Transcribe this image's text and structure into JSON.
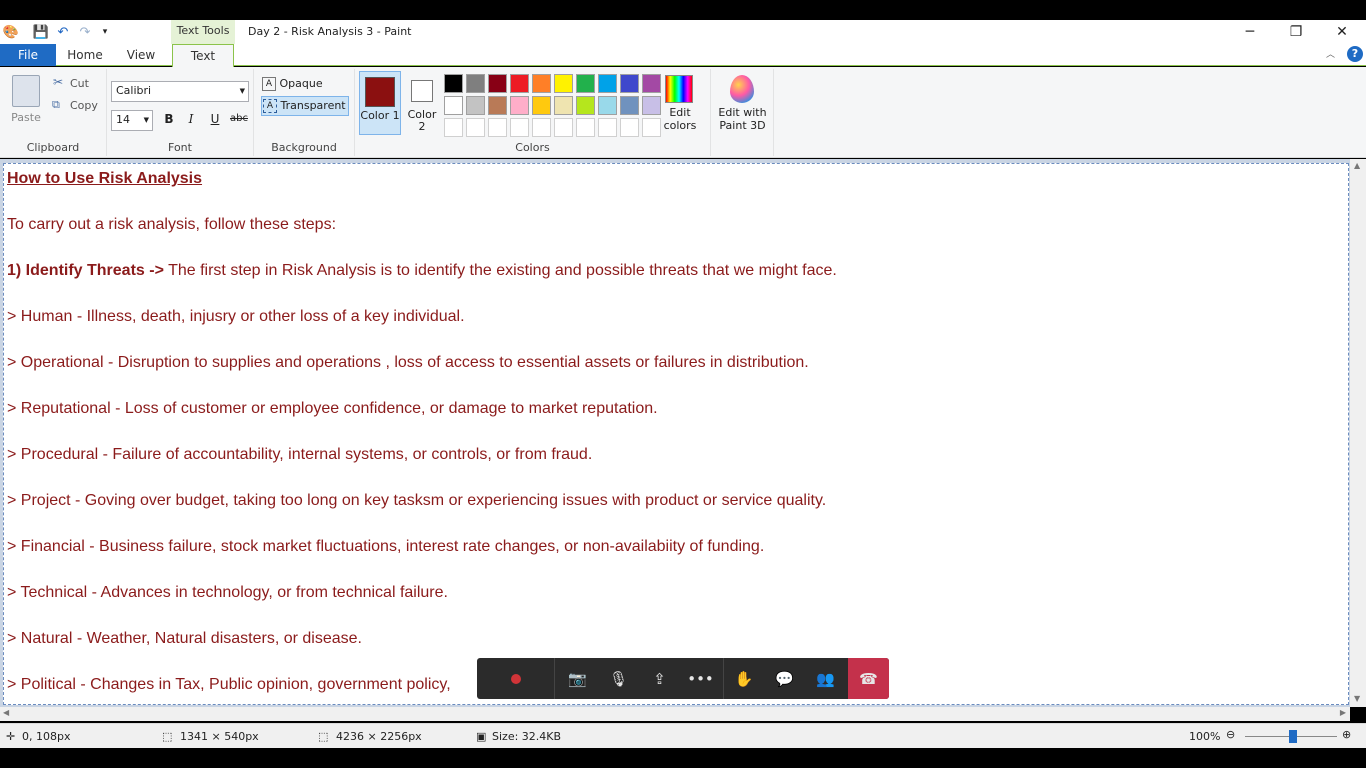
{
  "window": {
    "title": "Day 2 - Risk Analysis 3 - Paint",
    "contextual_tab": "Text Tools"
  },
  "tabs": {
    "file": "File",
    "home": "Home",
    "view": "View",
    "text": "Text"
  },
  "ribbon": {
    "clipboard": {
      "paste": "Paste",
      "cut": "Cut",
      "copy": "Copy",
      "label": "Clipboard"
    },
    "font": {
      "family": "Calibri",
      "size": "14",
      "bold": "B",
      "italic": "I",
      "underline": "U",
      "strike": "abc",
      "label": "Font"
    },
    "background": {
      "opaque": "Opaque",
      "transparent": "Transparent",
      "label": "Background"
    },
    "colors": {
      "color1": "Color 1",
      "color2": "Color 2",
      "edit": "Edit colors",
      "label": "Colors",
      "color1_value": "#8b1010",
      "color2_value": "#ffffff",
      "palette_row1": [
        "#000000",
        "#7f7f7f",
        "#880015",
        "#ed1c24",
        "#ff7f27",
        "#fff200",
        "#22b14c",
        "#00a2e8",
        "#3f48cc",
        "#a349a4"
      ],
      "palette_row2": [
        "#ffffff",
        "#c3c3c3",
        "#b97a57",
        "#ffaec9",
        "#ffc90e",
        "#efe4b0",
        "#b5e61d",
        "#99d9ea",
        "#7092be",
        "#c8bfe7"
      ]
    },
    "paint3d": "Edit with Paint 3D"
  },
  "document": {
    "heading": "How to Use Risk Analysis",
    "intro": "To carry out a risk analysis, follow these steps:",
    "step1_bold": "1) Identify Threats ->",
    "step1_text": " The first step in Risk Analysis is to identify the existing and possible threats that we might face.",
    "items": [
      "> Human - Illness, death, injusry or other loss of a key individual.",
      "> Operational - Disruption to supplies and operations , loss of access to essential assets or failures in distribution.",
      "> Reputational - Loss of customer or employee confidence, or damage to market reputation.",
      "> Procedural - Failure of accountability, internal systems, or controls, or from fraud.",
      "> Project - Goving over budget, taking too long on key tasksm or experiencing issues with product or service quality.",
      "> Financial - Business failure, stock market fluctuations, interest rate changes, or non-availabiity of funding.",
      "> Technical - Advances in technology, or from technical failure.",
      "> Natural - Weather, Natural disasters, or disease.",
      "> Political - Changes in Tax, Public opinion, government policy,"
    ]
  },
  "status": {
    "cursor": "0, 108px",
    "selection": "1341 × 540px",
    "image_size": "4236 × 2256px",
    "file_size": "Size: 32.4KB",
    "zoom": "100%"
  }
}
